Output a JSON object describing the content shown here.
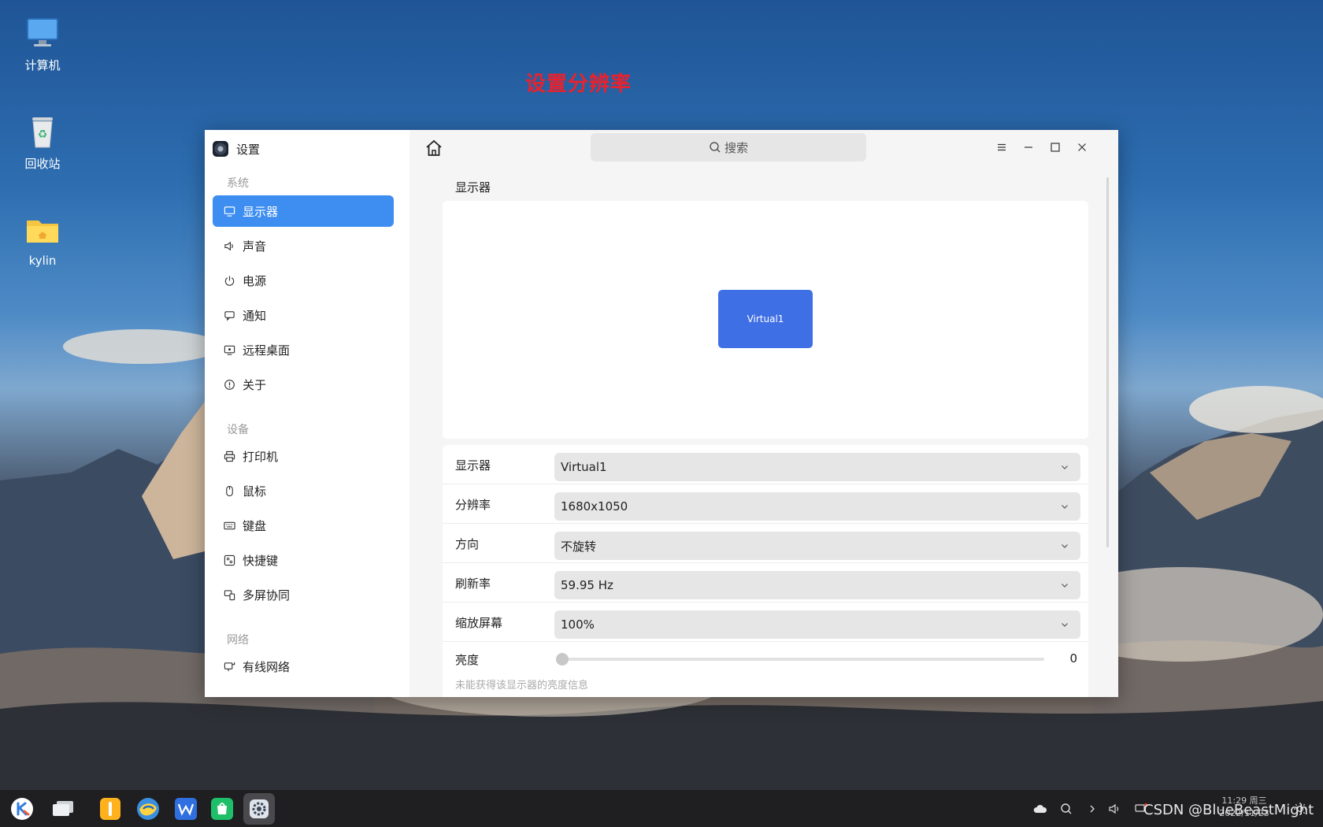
{
  "desktop": {
    "icons": [
      {
        "label": "计算机"
      },
      {
        "label": "回收站"
      },
      {
        "label": "kylin"
      }
    ],
    "annotation": "设置分辨率",
    "watermark": "CSDN @BlueBeastMight"
  },
  "window": {
    "app_name": "设置",
    "search_placeholder": "搜索",
    "sidebar": {
      "groups": [
        {
          "label": "系统"
        },
        {
          "label": "设备"
        },
        {
          "label": "网络"
        }
      ],
      "items": [
        {
          "label": "显示器",
          "icon": "monitor-icon",
          "active": true
        },
        {
          "label": "声音",
          "icon": "speaker-icon"
        },
        {
          "label": "电源",
          "icon": "power-icon"
        },
        {
          "label": "通知",
          "icon": "notification-icon"
        },
        {
          "label": "远程桌面",
          "icon": "remote-desktop-icon"
        },
        {
          "label": "关于",
          "icon": "info-icon"
        },
        {
          "label": "打印机",
          "icon": "printer-icon"
        },
        {
          "label": "鼠标",
          "icon": "mouse-icon"
        },
        {
          "label": "键盘",
          "icon": "keyboard-icon"
        },
        {
          "label": "快捷键",
          "icon": "shortcut-icon"
        },
        {
          "label": "多屏协同",
          "icon": "multi-screen-icon"
        },
        {
          "label": "有线网络",
          "icon": "wired-network-icon"
        }
      ]
    },
    "main": {
      "section_title": "显示器",
      "monitor_preview_label": "Virtual1",
      "rows": [
        {
          "label": "显示器",
          "value": "Virtual1"
        },
        {
          "label": "分辨率",
          "value": "1680x1050"
        },
        {
          "label": "方向",
          "value": "不旋转"
        },
        {
          "label": "刷新率",
          "value": "59.95 Hz"
        },
        {
          "label": "缩放屏幕",
          "value": "100%"
        }
      ],
      "brightness": {
        "label": "亮度",
        "value": "0",
        "level": 0,
        "hint": "未能获得该显示器的亮度信息"
      }
    }
  },
  "taskbar": {
    "clock_time": "11:29 周三",
    "clock_date": "2022/11/23"
  },
  "colors": {
    "accent": "#3d8ef0",
    "monitor_block": "#3f6fe4",
    "annotation": "#e8222e",
    "taskbar": "#1f1f22"
  }
}
